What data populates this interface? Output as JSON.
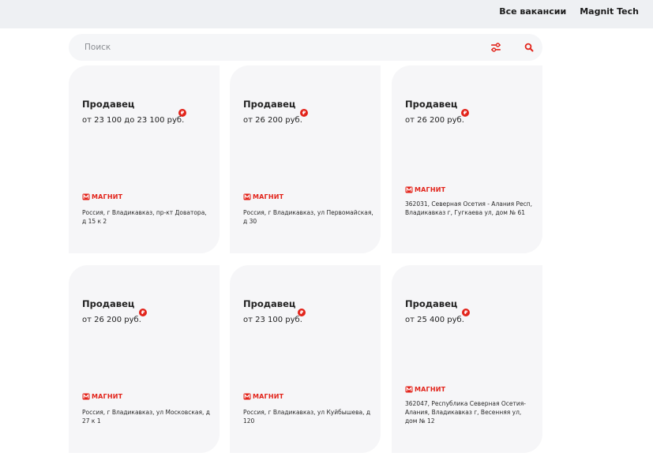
{
  "colors": {
    "accent": "#e2231a",
    "card_bg": "#f6f6f8",
    "header_bg": "#eef0f3"
  },
  "nav": {
    "all_vacancies": "Все вакансии",
    "magnit_tech": "Magnit Tech"
  },
  "search": {
    "placeholder": "Поиск",
    "filter_icon": "filter-sliders-icon",
    "search_icon": "search-icon"
  },
  "vacancies": [
    {
      "title": "Продавец",
      "salary": "от 23 100 до 23 100 руб.",
      "rub_badge": "₽",
      "brand": "МАГНИТ",
      "address": "Россия, г Владикавказ, пр-кт Доватора, д 15 к 2"
    },
    {
      "title": "Продавец",
      "salary": "от 26 200 руб.",
      "rub_badge": "₽",
      "brand": "МАГНИТ",
      "address": "Россия, г Владикавказ, ул Первомайская, д 30"
    },
    {
      "title": "Продавец",
      "salary": "от 26 200 руб.",
      "rub_badge": "₽",
      "brand": "МАГНИТ",
      "address": "362031, Северная Осетия - Алания Респ, Владикавказ г, Гугкаева ул, дом № 61"
    },
    {
      "title": "Продавец",
      "salary": "от 26 200 руб.",
      "rub_badge": "₽",
      "brand": "МАГНИТ",
      "address": "Россия, г Владикавказ, ул Московская, д 27 к 1"
    },
    {
      "title": "Продавец",
      "salary": "от 23 100 руб.",
      "rub_badge": "₽",
      "brand": "МАГНИТ",
      "address": "Россия, г Владикавказ, ул Куйбышева, д 120"
    },
    {
      "title": "Продавец",
      "salary": "от 25 400 руб.",
      "rub_badge": "₽",
      "brand": "МАГНИТ",
      "address": "362047, Республика Северная Осетия-Алания, Владикавказ г, Весенняя ул, дом № 12"
    }
  ]
}
